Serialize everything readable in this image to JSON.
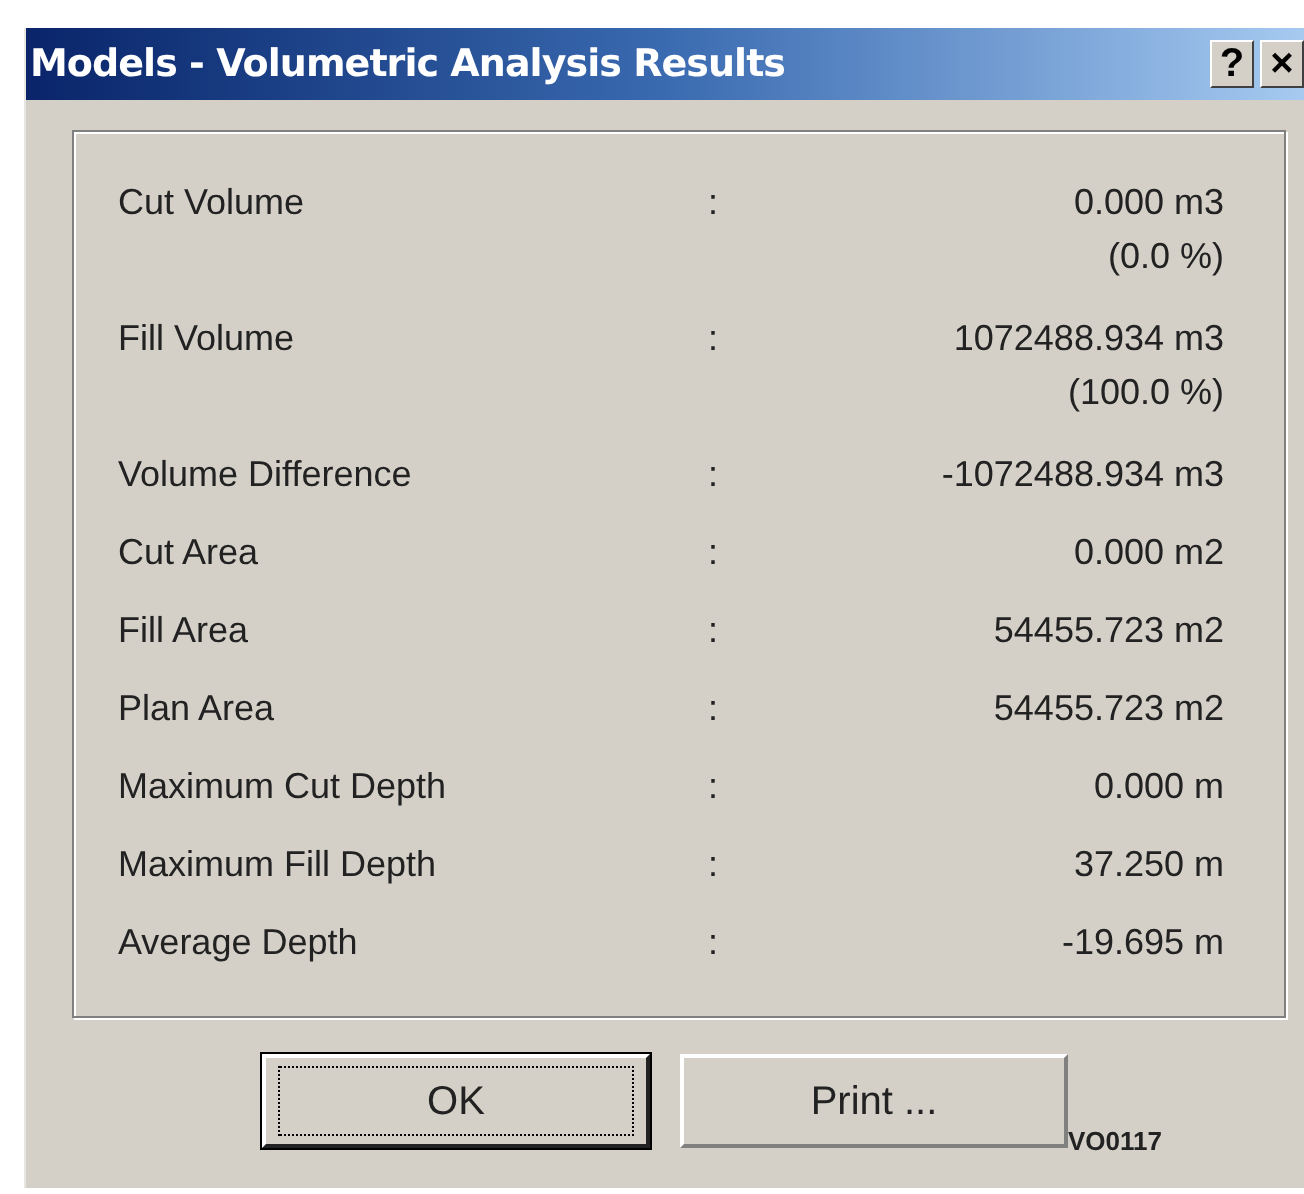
{
  "window": {
    "title": "Models - Volumetric Analysis Results",
    "title_buttons": [
      "?",
      "×"
    ]
  },
  "rows": [
    {
      "label": "Cut Volume",
      "separator": ":",
      "value": "0.000 m3",
      "detail": "(0.0 %)"
    },
    {
      "label": "Fill Volume",
      "separator": ":",
      "value": "1072488.934 m3",
      "detail": "(100.0 %)"
    },
    {
      "label": "Volume Difference",
      "separator": ":",
      "value": "-1072488.934 m3"
    },
    {
      "label": "Cut Area",
      "separator": ":",
      "value": "0.000 m2"
    },
    {
      "label": "Fill Area",
      "separator": ":",
      "value": "54455.723 m2"
    },
    {
      "label": "Plan Area",
      "separator": ":",
      "value": "54455.723 m2"
    },
    {
      "label": "Maximum Cut Depth",
      "separator": ":",
      "value": "0.000 m"
    },
    {
      "label": "Maximum Fill Depth",
      "separator": ":",
      "value": "37.250 m"
    },
    {
      "label": "Average Depth",
      "separator": ":",
      "value": "-19.695 m"
    }
  ],
  "buttons": [
    {
      "label": "OK",
      "focused": true
    },
    {
      "label": "Print ...",
      "focused": false
    }
  ],
  "code": "VO0117"
}
